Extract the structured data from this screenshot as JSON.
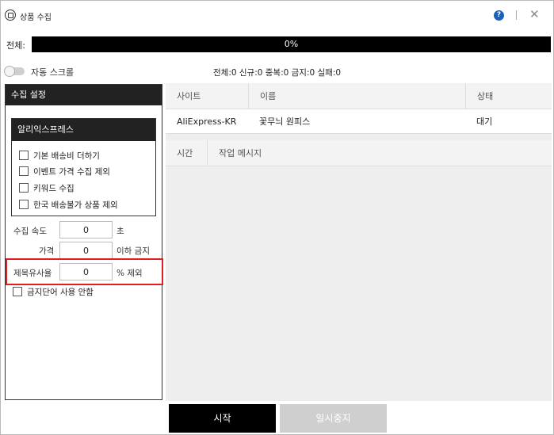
{
  "window": {
    "title": "상품 수집",
    "help_glyph": "?",
    "close_glyph": "✕"
  },
  "progress": {
    "label": "전체:",
    "percent_text": "0%",
    "value": 0
  },
  "auto_scroll": {
    "label": "자동 스크롤",
    "enabled": false
  },
  "stats": {
    "text": "전체:0 신규:0 중복:0 금지:0 실패:0"
  },
  "settings": {
    "header": "수집 설정",
    "aliexpress": {
      "header": "알리익스프레스",
      "options": [
        {
          "label": "기본 배송비 더하기",
          "checked": false
        },
        {
          "label": "이벤트 가격 수집 제외",
          "checked": false
        },
        {
          "label": "키워드 수집",
          "checked": false
        },
        {
          "label": "한국 배송불가 상품 제외",
          "checked": false
        }
      ]
    },
    "speed": {
      "label": "수집 속도",
      "value": "0",
      "suffix": "초"
    },
    "price": {
      "label": "가격",
      "value": "0",
      "suffix": "이하 금지"
    },
    "similarity": {
      "label": "제목유사율",
      "value": "0",
      "suffix": "% 제외"
    },
    "banned_words": {
      "label": "금지단어 사용 안함",
      "checked": false
    }
  },
  "product_table": {
    "columns": [
      "사이트",
      "이름",
      "상태"
    ],
    "rows": [
      {
        "site": "AliExpress-KR",
        "name": "꽃무늬 원피스",
        "status": "대기"
      }
    ]
  },
  "log_table": {
    "columns": [
      "시간",
      "작업 메시지"
    ]
  },
  "buttons": {
    "start": "시작",
    "pause": "일시중지"
  },
  "colors": {
    "dark": "#222222",
    "highlight": "#e02020",
    "help_blue": "#1b5fbf",
    "disabled": "#cfcfcf"
  }
}
